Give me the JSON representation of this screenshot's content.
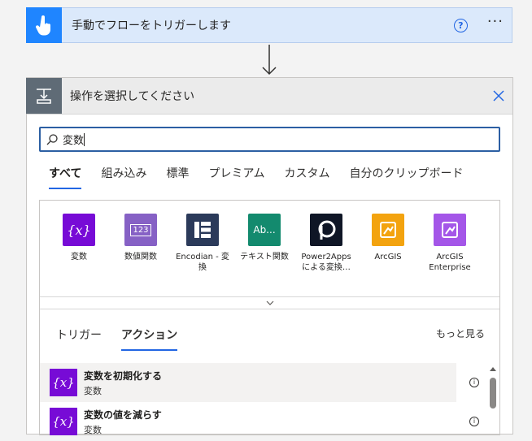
{
  "trigger": {
    "title": "手動でフローをトリガーします",
    "help_icon": "?",
    "more_icon": "···"
  },
  "action_panel": {
    "title": "操作を選択してください",
    "search": {
      "value": "変数",
      "placeholder": ""
    },
    "tabs": [
      {
        "label": "すべて",
        "active": true
      },
      {
        "label": "組み込み",
        "active": false
      },
      {
        "label": "標準",
        "active": false
      },
      {
        "label": "プレミアム",
        "active": false
      },
      {
        "label": "カスタム",
        "active": false
      },
      {
        "label": "自分のクリップボード",
        "active": false
      }
    ],
    "connectors": [
      {
        "label": "変数",
        "tile_text": "{x}",
        "color": "#770bd6"
      },
      {
        "label": "数値関数",
        "tile_text": "123",
        "color": "#8661c5"
      },
      {
        "label": "Encodian - 変換",
        "tile_text": "",
        "color": "#2b3a5a"
      },
      {
        "label": "テキスト関数",
        "tile_text": "Ab...",
        "color": "#138a6e"
      },
      {
        "label": "Power2Apps による変換…",
        "tile_text": "",
        "color": "#0f1626"
      },
      {
        "label": "ArcGIS",
        "tile_text": "",
        "color": "#f3a30f"
      },
      {
        "label": "ArcGIS Enterprise",
        "tile_text": "",
        "color": "#a456e8"
      }
    ],
    "sub_tabs": [
      {
        "label": "トリガー",
        "active": false
      },
      {
        "label": "アクション",
        "active": true
      }
    ],
    "see_more": "もっと見る",
    "actions": [
      {
        "title": "変数を初期化する",
        "subtitle": "変数",
        "icon_text": "{x}"
      },
      {
        "title": "変数の値を減らす",
        "subtitle": "変数",
        "icon_text": "{x}"
      }
    ]
  },
  "colors": {
    "accent": "#2266e3",
    "trigger_bg": "#dbe9fb",
    "trigger_icon": "#1f85ff",
    "variables": "#770bd6"
  }
}
